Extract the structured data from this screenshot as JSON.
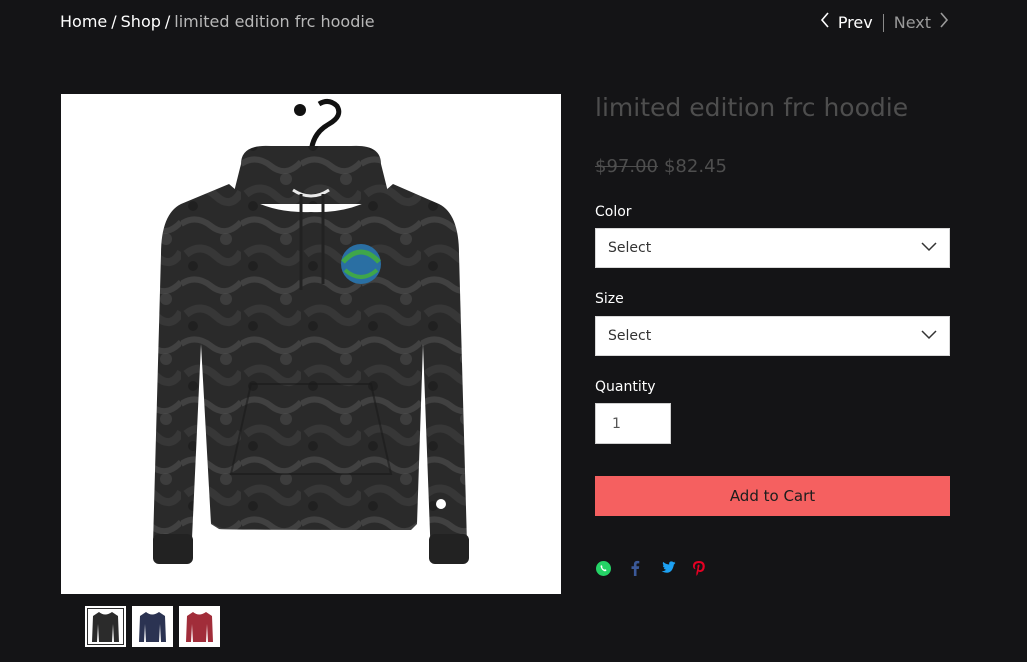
{
  "breadcrumb": {
    "home": "Home",
    "shop": "Shop",
    "current": "limited edition frc hoodie",
    "separator": "/"
  },
  "pager": {
    "prev": "Prev",
    "next": "Next"
  },
  "product": {
    "title": "limited edition frc hoodie",
    "original_price": "$97.00",
    "sale_price": "$82.45",
    "image_alt": "Black tie-dye hoodie on hanger",
    "thumbnails": [
      "black hoodie",
      "navy hoodie",
      "red hoodie"
    ]
  },
  "options": {
    "color_label": "Color",
    "color_value": "Select",
    "size_label": "Size",
    "size_value": "Select"
  },
  "quantity": {
    "label": "Quantity",
    "value": "1"
  },
  "cart": {
    "button_label": "Add to Cart"
  },
  "share": {
    "icons": [
      "whatsapp-icon",
      "facebook-icon",
      "twitter-icon",
      "pinterest-icon"
    ]
  },
  "colors": {
    "background": "#141416",
    "accent": "#f56060",
    "title_text": "#4e4e4e"
  }
}
